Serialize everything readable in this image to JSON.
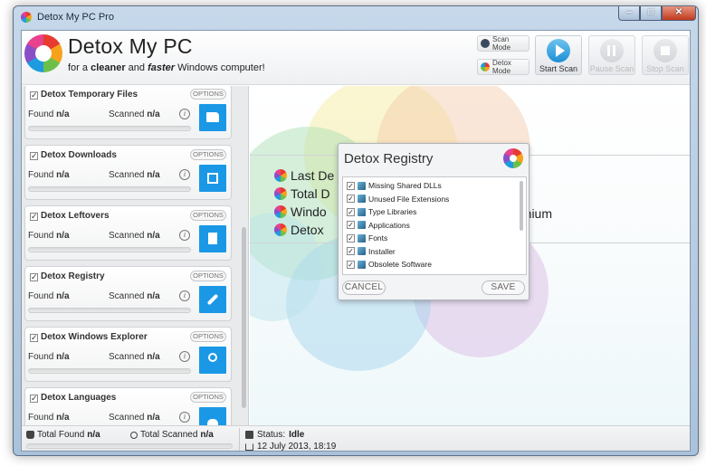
{
  "window": {
    "title": "Detox My PC Pro",
    "controls": {
      "minimize": "–",
      "maximize": "□",
      "close": "✕"
    }
  },
  "header": {
    "brand": "Detox My PC",
    "tagline_pre": "for a ",
    "tagline_bold1": "cleaner",
    "tagline_mid": " and ",
    "tagline_bold2": "faster",
    "tagline_post": " Windows computer!",
    "scan_mode_label": "Scan Mode",
    "detox_mode_label": "Detox Mode",
    "start_scan_label": "Start Scan",
    "pause_scan_label": "Pause Scan",
    "stop_scan_label": "Stop Scan"
  },
  "modules": [
    {
      "title": "Detox Temporary Files",
      "options": "OPTIONS",
      "found_label": "Found",
      "found_value": "n/a",
      "scanned_label": "Scanned",
      "scanned_value": "n/a",
      "icon": "folder-icon",
      "checked": "✓",
      "info": "i"
    },
    {
      "title": "Detox Downloads",
      "options": "OPTIONS",
      "found_label": "Found",
      "found_value": "n/a",
      "scanned_label": "Scanned",
      "scanned_value": "n/a",
      "icon": "download-icon",
      "checked": "✓",
      "info": "i"
    },
    {
      "title": "Detox Leftovers",
      "options": "OPTIONS",
      "found_label": "Found",
      "found_value": "n/a",
      "scanned_label": "Scanned",
      "scanned_value": "n/a",
      "icon": "document-icon",
      "checked": "✓",
      "info": "i"
    },
    {
      "title": "Detox Registry",
      "options": "OPTIONS",
      "found_label": "Found",
      "found_value": "n/a",
      "scanned_label": "Scanned",
      "scanned_value": "n/a",
      "icon": "wrench-icon",
      "checked": "✓",
      "info": "i"
    },
    {
      "title": "Detox Windows Explorer",
      "options": "OPTIONS",
      "found_label": "Found",
      "found_value": "n/a",
      "scanned_label": "Scanned",
      "scanned_value": "n/a",
      "icon": "magnifier-icon",
      "checked": "✓",
      "info": "i"
    },
    {
      "title": "Detox Languages",
      "options": "OPTIONS",
      "found_label": "Found",
      "found_value": "n/a",
      "scanned_label": "Scanned",
      "scanned_value": "n/a",
      "icon": "people-icon",
      "checked": "✓",
      "info": "i"
    }
  ],
  "main": {
    "rows": [
      "Last De",
      "Total D",
      "Windo",
      "Detox"
    ],
    "premium_text": "emium"
  },
  "dialog": {
    "title": "Detox Registry",
    "items": [
      {
        "label": "Missing Shared DLLs",
        "checked": "✓"
      },
      {
        "label": "Unused File Extensions",
        "checked": "✓"
      },
      {
        "label": "Type Libraries",
        "checked": "✓"
      },
      {
        "label": "Applications",
        "checked": "✓"
      },
      {
        "label": "Fonts",
        "checked": "✓"
      },
      {
        "label": "Installer",
        "checked": "✓"
      },
      {
        "label": "Obsolete Software",
        "checked": "✓"
      }
    ],
    "cancel_label": "CANCEL",
    "save_label": "SAVE"
  },
  "status": {
    "total_found_label": "Total Found",
    "total_found_value": "n/a",
    "total_scanned_label": "Total Scanned",
    "total_scanned_value": "n/a",
    "status_label": "Status:",
    "status_value": "Idle",
    "date": "12 July 2013, 18:19"
  },
  "colors": {
    "accent": "#1a98e6",
    "background": "#e9eaeb"
  }
}
